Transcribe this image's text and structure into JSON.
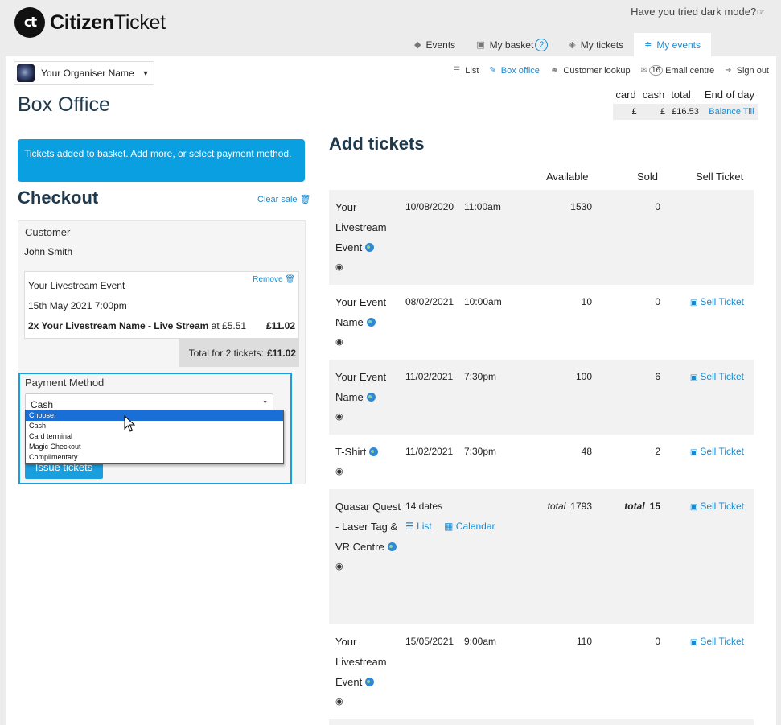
{
  "brand": {
    "logo_mark": "ct",
    "name_bold": "Citizen",
    "name_rest": "Ticket"
  },
  "dark_mode": {
    "text": "Have you tried dark mode?",
    "icon": "hand-pointer-icon"
  },
  "top_tabs": [
    {
      "label": "Events",
      "icon": "tag-icon"
    },
    {
      "label": "My basket",
      "icon": "basket-icon",
      "badge": "2"
    },
    {
      "label": "My tickets",
      "icon": "ticket-icon"
    },
    {
      "label": "My events",
      "icon": "sliders-icon",
      "active": true
    }
  ],
  "organiser": {
    "name": "Your Organiser Name"
  },
  "sub_nav": [
    {
      "label": "List",
      "icon": "list-icon"
    },
    {
      "label": "Box office",
      "icon": "pencil-icon",
      "active": true
    },
    {
      "label": "Customer lookup",
      "icon": "users-icon"
    },
    {
      "label": "Email centre",
      "icon": "envelope-icon",
      "badge": "16"
    },
    {
      "label": "Sign out",
      "icon": "sign-out-icon"
    }
  ],
  "page_title": "Box Office",
  "till": {
    "headers": [
      "card",
      "cash",
      "total",
      "End of day"
    ],
    "card": "£",
    "cash": "£",
    "total": "£16.53",
    "balance_link": "Balance Till"
  },
  "notice": "Tickets added to basket. Add more, or select payment method.",
  "checkout": {
    "title": "Checkout",
    "clear_sale": "Clear sale",
    "customer_label": "Customer",
    "customer_name": "John Smith",
    "item": {
      "remove": "Remove",
      "event": "Your Livestream Event",
      "date": "15th May 2021 7:00pm",
      "qty_name": "2x Your Livestream Name - Live Stream",
      "at": "at £5.51",
      "price": "£11.02"
    },
    "total_label": "Total for 2 tickets:",
    "total_value": "£11.02",
    "payment_label": "Payment Method",
    "payment_selected": "Cash",
    "payment_options": [
      "Choose:",
      "Cash",
      "Card terminal",
      "Magic Checkout",
      "Complimentary"
    ],
    "issue_button": "Issue tickets"
  },
  "add_tickets": {
    "title": "Add tickets",
    "headers": {
      "available": "Available",
      "sold": "Sold",
      "sell": "Sell Ticket"
    },
    "rows": [
      {
        "name": "Your Livestream Event",
        "date": "10/08/2020",
        "time": "11:00am",
        "available": "1530",
        "sold": "0",
        "sell": ""
      },
      {
        "name": "Your Event Name",
        "date": "08/02/2021",
        "time": "10:00am",
        "available": "10",
        "sold": "0",
        "sell": "Sell Ticket"
      },
      {
        "name": "Your Event Name",
        "date": "11/02/2021",
        "time": "7:30pm",
        "available": "100",
        "sold": "6",
        "sell": "Sell Ticket"
      },
      {
        "name": "T-Shirt",
        "date": "11/02/2021",
        "time": "7:30pm",
        "available": "48",
        "sold": "2",
        "sell": "Sell Ticket"
      },
      {
        "name": "Quasar Quest - Laser Tag & VR Centre",
        "dates": "14 dates",
        "list": "List",
        "calendar": "Calendar",
        "total_label": "total",
        "available": "1793",
        "sold": "15",
        "sell": "Sell Ticket"
      },
      {
        "name": "Your Livestream Event",
        "date": "15/05/2021",
        "time": "9:00am",
        "available": "110",
        "sold": "0",
        "sell": "Sell Ticket"
      }
    ]
  },
  "colors": {
    "accent": "#1a9fde",
    "link": "#1a8ad0",
    "title": "#1f3a4d"
  }
}
